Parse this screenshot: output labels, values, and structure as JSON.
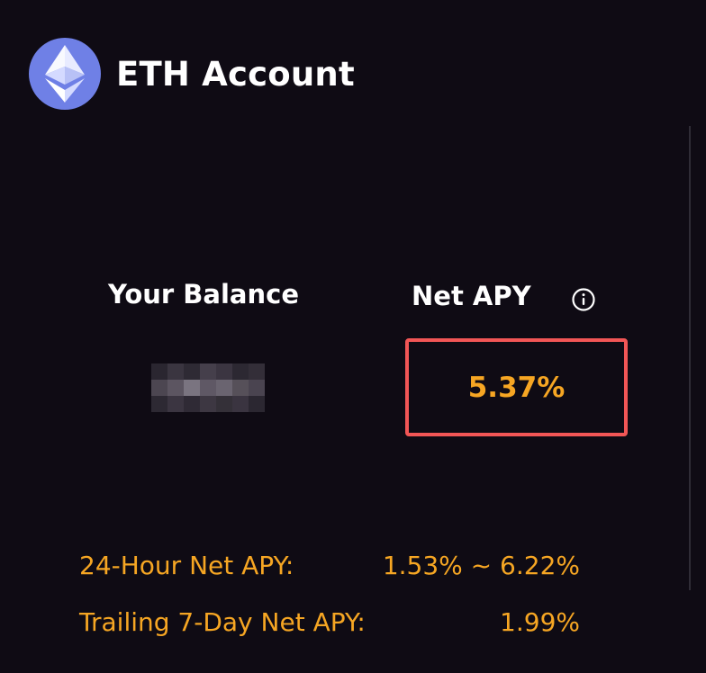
{
  "header": {
    "title": "ETH Account",
    "logo_icon": "ethereum-icon"
  },
  "balance": {
    "label": "Your Balance",
    "value_state": "redacted"
  },
  "apy": {
    "label": "Net APY",
    "info_icon": "info-icon",
    "value": "5.37%"
  },
  "stats": [
    {
      "label": "24-Hour Net APY:",
      "value": "1.53% ~ 6.22%"
    },
    {
      "label": "Trailing 7-Day Net APY:",
      "value": "1.99%"
    }
  ],
  "colors": {
    "background": "#0f0b14",
    "accent": "#f6a623",
    "highlight_border": "#f25656",
    "eth_blue": "#6f80e6"
  }
}
